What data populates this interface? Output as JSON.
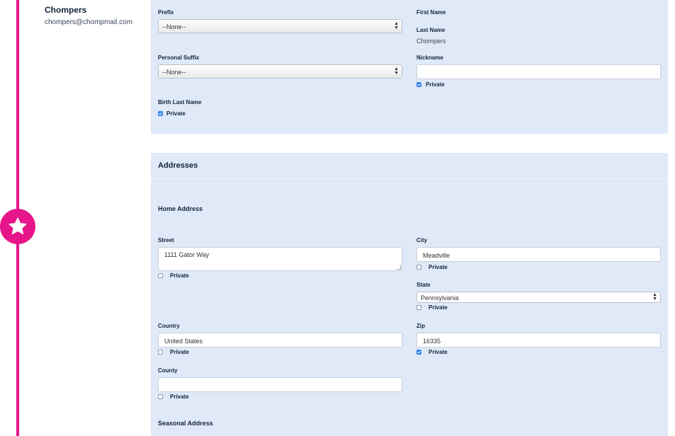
{
  "profile": {
    "name": "Chompers",
    "email": "chompers@chompmail.com"
  },
  "timeline": {
    "accent": "#e6168a",
    "icon": "star-icon"
  },
  "name_section": {
    "prefix": {
      "label": "Prefix",
      "value": "--None--"
    },
    "personal_suffix": {
      "label": "Personal Suffix",
      "value": "--None--"
    },
    "birth_last_name": {
      "label": "Birth Last Name",
      "private_label": "Private",
      "private_checked": true
    },
    "first_name": {
      "label": "First Name",
      "value": ""
    },
    "last_name": {
      "label": "Last Name",
      "value": "Chompers"
    },
    "nickname": {
      "label": "Nickname",
      "value": "",
      "private_label": "Private",
      "private_checked": true
    }
  },
  "addresses": {
    "title": "Addresses",
    "home": {
      "title": "Home Address",
      "street": {
        "label": "Street",
        "value": "1111 Gator Way",
        "private_label": "Private",
        "private_checked": false
      },
      "city": {
        "label": "City",
        "value": "Meadville",
        "private_label": "Private",
        "private_checked": false
      },
      "state": {
        "label": "State",
        "value": "Pennsylvania",
        "private_label": "Private",
        "private_checked": false
      },
      "country": {
        "label": "Country",
        "value": "United States",
        "private_label": "Private",
        "private_checked": false
      },
      "zip": {
        "label": "Zip",
        "value": "16335",
        "private_label": "Private",
        "private_checked": true
      },
      "county": {
        "label": "County",
        "value": "",
        "private_label": "Private",
        "private_checked": false
      }
    },
    "seasonal": {
      "title": "Seasonal Address"
    }
  },
  "colors": {
    "panel_bg": "#dfe9f8",
    "checkbox_on": "#2f7fe8"
  }
}
